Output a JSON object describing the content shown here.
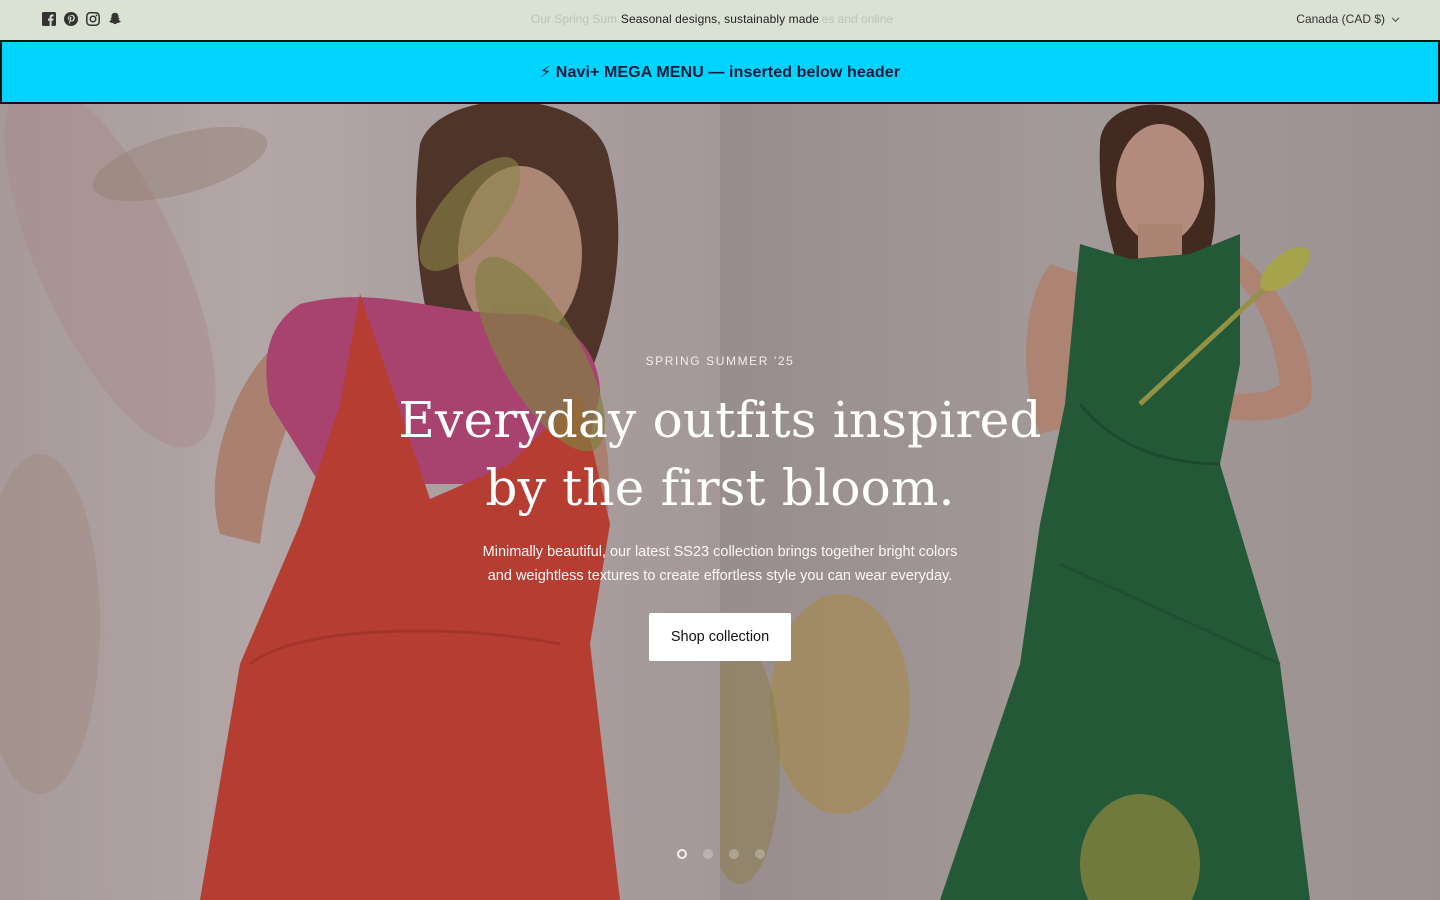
{
  "announcement": {
    "text": "Seasonal designs, sustainably made",
    "ghost_left": "Our Spring Sum",
    "ghost_right": "ores and online",
    "social": [
      "facebook-icon",
      "pinterest-icon",
      "instagram-icon",
      "snapchat-icon"
    ]
  },
  "locale": {
    "label": "Canada (CAD $)"
  },
  "navi_banner": {
    "text": "⚡ Navi+ MEGA MENU — inserted below header",
    "bg": "#00d4ff"
  },
  "hero": {
    "kicker": "SPRING SUMMER '25",
    "headline_line1": "Everyday outfits inspired",
    "headline_line2": "by the first bloom.",
    "sub_line1": "Minimally beautiful, our latest SS23 collection brings together bright colors",
    "sub_line2": "and weightless textures to create effortless style you can wear everyday.",
    "cta": "Shop collection",
    "slides": 4,
    "active_slide": 1
  },
  "colors": {
    "announcement_bg": "#d9e2d3",
    "left_dress": "#e14a37",
    "left_top": "#cf4f88",
    "right_dress": "#226a3f"
  }
}
